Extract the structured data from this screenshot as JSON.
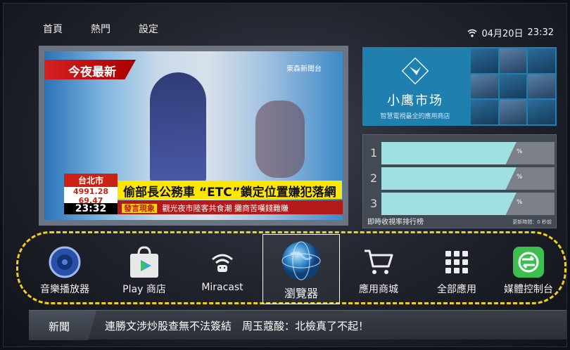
{
  "nav": {
    "tabs": [
      "首頁",
      "熱門",
      "設定"
    ]
  },
  "status": {
    "date": "04月20日",
    "time": "23:32"
  },
  "video": {
    "tag": "今夜最新",
    "channel": "東森新聞台",
    "headline": "偷部長公務車 “ETC”鎖定位置嫌犯落網",
    "ticker_badge": "發言現象",
    "ticker_text": "觀光夜市陸客共食潮 攤商苦嘆錢難賺",
    "stock_city": "台北市",
    "stock_value": "4991.28",
    "stock_change": "69.47",
    "clock": "23:32"
  },
  "store": {
    "title": "小鹰市场",
    "subtitle": "智慧電視最全的應用商店"
  },
  "ranking": {
    "rows": [
      {
        "rank": "1",
        "pct_label": "%",
        "fill": 0.78
      },
      {
        "rank": "2",
        "pct_label": "%",
        "fill": 0.78
      },
      {
        "rank": "3",
        "pct_label": "%",
        "fill": 0.78
      }
    ],
    "footer": "即時收視率排行榜",
    "update": "更新時間：0 秒前"
  },
  "apps": [
    {
      "label": "音樂播放器",
      "icon": "speaker-icon"
    },
    {
      "label": "Play 商店",
      "icon": "play-store-icon"
    },
    {
      "label": "Miracast",
      "icon": "miracast-icon"
    },
    {
      "label": "瀏覽器",
      "icon": "globe-icon"
    },
    {
      "label": "應用商城",
      "icon": "cart-icon"
    },
    {
      "label": "全部應用",
      "icon": "grid-icon"
    },
    {
      "label": "媒體控制台",
      "icon": "media-control-icon"
    }
  ],
  "newsbar": {
    "label": "新聞",
    "text": "連勝文涉炒股查無不法簽結　周玉蔻酸：北檢真了不起！"
  },
  "colors": {
    "accent": "#1f7fae",
    "highlight": "#f2d012",
    "bar": "#9fe0e0"
  }
}
